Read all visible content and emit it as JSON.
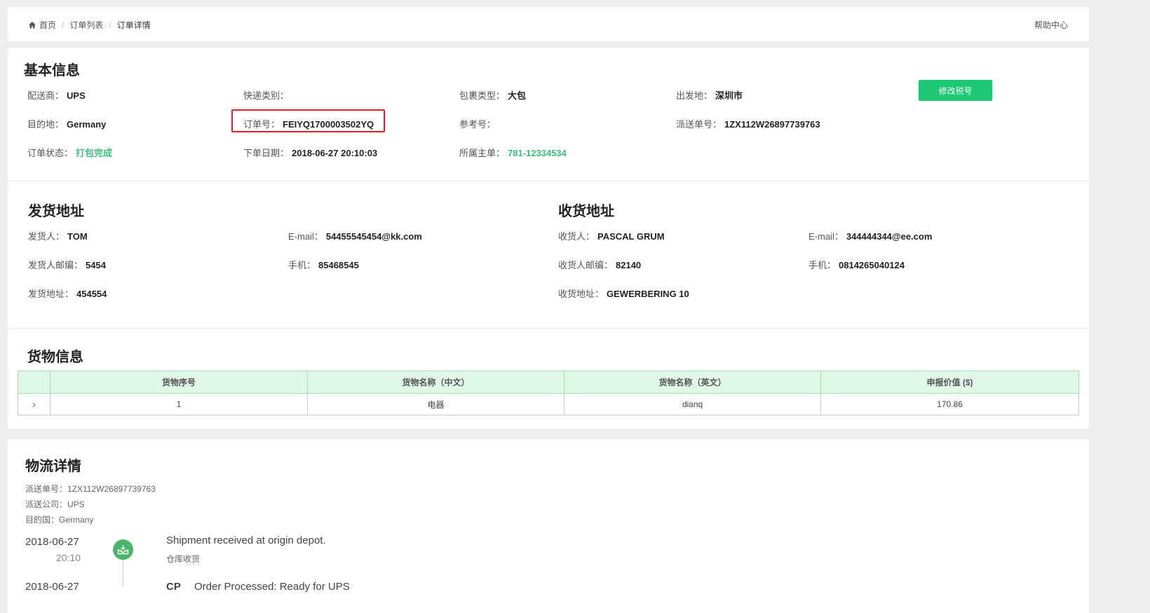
{
  "breadcrumb": {
    "home": "首页",
    "orders": "订单列表",
    "current": "订单详情",
    "separator": "/"
  },
  "help": "帮助中心",
  "basic": {
    "title": "基本信息",
    "carrier_label": "配送商：",
    "carrier": "UPS",
    "express_type_label": "快递类别：",
    "express_type": "",
    "package_type_label": "包裹类型：",
    "package_type": "大包",
    "origin_label": "出发地：",
    "origin": "深圳市",
    "destination_label": "目的地：",
    "destination": "Germany",
    "order_no_label": "订单号：",
    "order_no": "FEIYQ1700003502YQ",
    "ref_no_label": "参考号：",
    "ref_no": "",
    "tracking_label": "派送单号：",
    "tracking": "1ZX112W26897739763",
    "status_label": "订单状态：",
    "status": "打包完成",
    "order_date_label": "下单日期：",
    "order_date": "2018-06-27 20:10:03",
    "master_label": "所属主单：",
    "master": "781-12334534",
    "edit_tax_button": "修改税号"
  },
  "sender": {
    "title": "发货地址",
    "name_label": "发货人：",
    "name": "TOM",
    "email_label": "E-mail：",
    "email": "54455545454@kk.com",
    "zip_label": "发货人邮编：",
    "zip": "5454",
    "phone_label": "手机：",
    "phone": "85468545",
    "address_label": "发货地址：",
    "address": "454554"
  },
  "receiver": {
    "title": "收货地址",
    "name_label": "收货人：",
    "name": "PASCAL GRUM",
    "email_label": "E-mail：",
    "email": "344444344@ee.com",
    "zip_label": "收货人邮编：",
    "zip": "82140",
    "phone_label": "手机：",
    "phone": "0814265040124",
    "address_label": "收货地址：",
    "address": "GEWERBERING 10"
  },
  "goods": {
    "title": "货物信息",
    "columns": [
      "",
      "货物序号",
      "货物名称（中文）",
      "货物名称（英文）",
      "申报价值 ($)"
    ],
    "rows": [
      {
        "expand": "›",
        "seq": "1",
        "name_cn": "电器",
        "name_en": "dianq",
        "value": "170.86"
      }
    ]
  },
  "logistics": {
    "title": "物流详情",
    "tracking_line": "派送单号：1ZX112W26897739763",
    "company_line": "派送公司：UPS",
    "country_line": "目的国：Germany",
    "events": [
      {
        "date": "2018-06-27",
        "time": "20:10",
        "event": "Shipment received at origin depot.",
        "sub": "仓库收货"
      },
      {
        "date": "2018-06-27",
        "code": "CP",
        "event": "Order Processed: Ready for UPS"
      }
    ]
  },
  "colors": {
    "accent_green": "#1ec773",
    "highlight_red": "#e02020",
    "table_header_bg": "#e0f8e8",
    "status_green": "#3dbd7d"
  },
  "icons": {
    "home": "home-icon",
    "timeline": "inbox-download-icon",
    "expand": "chevron-right-icon"
  }
}
